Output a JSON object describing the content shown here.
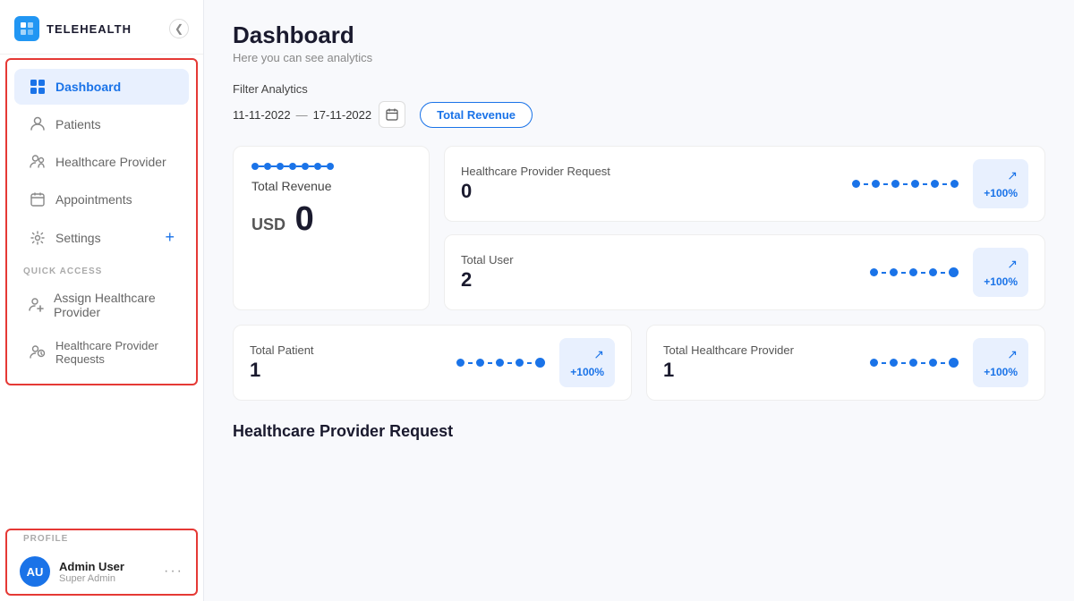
{
  "app": {
    "name": "TELEHEALTH",
    "logo_text": "AU"
  },
  "sidebar": {
    "items": [
      {
        "id": "dashboard",
        "label": "Dashboard",
        "active": true
      },
      {
        "id": "patients",
        "label": "Patients",
        "active": false
      },
      {
        "id": "healthcare-provider",
        "label": "Healthcare Provider",
        "active": false
      },
      {
        "id": "appointments",
        "label": "Appointments",
        "active": false
      },
      {
        "id": "settings",
        "label": "Settings",
        "active": false
      }
    ],
    "quick_access_label": "QUICK ACCESS",
    "quick_access_items": [
      {
        "id": "assign-hp",
        "label": "Assign Healthcare Provider"
      },
      {
        "id": "hp-requests",
        "label": "Healthcare Provider Requests"
      }
    ],
    "profile_label": "PROFILE",
    "profile": {
      "initials": "AU",
      "name": "Admin User",
      "role": "Super Admin"
    }
  },
  "page": {
    "title": "Dashboard",
    "subtitle": "Here you can see analytics"
  },
  "filter": {
    "label": "Filter Analytics",
    "date_from": "11-11-2022",
    "date_to": "17-11-2022",
    "separator": "—",
    "button_label": "Total Revenue"
  },
  "stats": {
    "total_revenue": {
      "label": "Total Revenue",
      "value": "0",
      "prefix": "USD"
    },
    "hp_request": {
      "label": "Healthcare Provider Request",
      "value": "0",
      "trend": "+100%"
    },
    "total_user": {
      "label": "Total User",
      "value": "2",
      "trend": "+100%"
    },
    "total_patient": {
      "label": "Total Patient",
      "value": "1",
      "trend": "+100%"
    },
    "total_hp": {
      "label": "Total Healthcare Provider",
      "value": "1",
      "trend": "+100%"
    }
  },
  "bottom_section": {
    "title": "Healthcare Provider Request"
  },
  "icons": {
    "chevron_left": "❮",
    "calendar": "📅",
    "trend_up": "↗",
    "dots": "•••"
  }
}
